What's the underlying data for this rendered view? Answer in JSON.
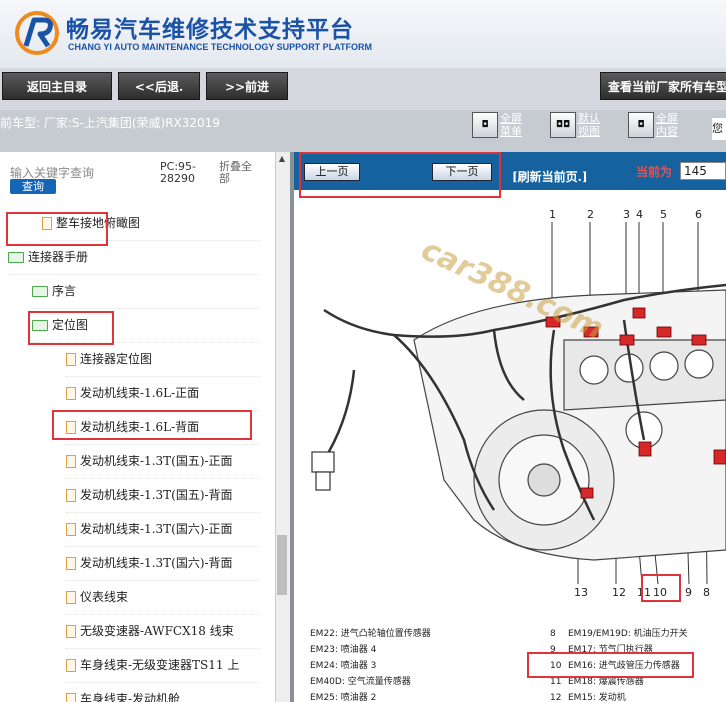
{
  "header": {
    "title_cn": "畅易汽车维修技术支持平台",
    "title_en": "CHANG YI AUTO MAINTENANCE TECHNOLOGY SUPPORT PLATFORM"
  },
  "nav": {
    "home": "返回主目录",
    "back": "<<后退.",
    "forward": ">>前进",
    "view_all": "查看当前厂家所有车型"
  },
  "infobar": {
    "car_model": "前车型:  厂家:S-上汽集团(荣威)RX32019",
    "btn_fullscreen_menu": "全屏菜单",
    "btn_default_view": "默认视图",
    "btn_fullscreen_content": "全屏内容",
    "right_text": "您"
  },
  "left": {
    "search_placeholder": "输入关键字查询",
    "search_button": "查询",
    "pc_label": "PC:95-28290",
    "collapse_all": "折叠全部",
    "tree": [
      {
        "label": "整车接地俯瞰图",
        "type": "file",
        "indent": 42
      },
      {
        "label": "连接器手册",
        "type": "folder",
        "indent": 8
      },
      {
        "label": "序言",
        "type": "folder",
        "indent": 32
      },
      {
        "label": "定位图",
        "type": "folder",
        "indent": 32
      },
      {
        "label": "连接器定位图",
        "type": "file",
        "indent": 66
      },
      {
        "label": "发动机线束-1.6L-正面",
        "type": "file",
        "indent": 66
      },
      {
        "label": "发动机线束-1.6L-背面",
        "type": "file",
        "indent": 66
      },
      {
        "label": "发动机线束-1.3T(国五)-正面",
        "type": "file",
        "indent": 66
      },
      {
        "label": "发动机线束-1.3T(国五)-背面",
        "type": "file",
        "indent": 66
      },
      {
        "label": "发动机线束-1.3T(国六)-正面",
        "type": "file",
        "indent": 66
      },
      {
        "label": "发动机线束-1.3T(国六)-背面",
        "type": "file",
        "indent": 66
      },
      {
        "label": "仪表线束",
        "type": "file",
        "indent": 66
      },
      {
        "label": "无级变速器-AWFCX18 线束",
        "type": "file",
        "indent": 66
      },
      {
        "label": "车身线束-无级变速器TS11 上",
        "type": "file",
        "indent": 66
      },
      {
        "label": "车身线束-发动机舱",
        "type": "file",
        "indent": 66
      }
    ]
  },
  "viewer": {
    "prev": "上一页",
    "next": "下一页",
    "refresh": "[刷新当前页.]",
    "current_page_label": "当前为",
    "current_page": "145",
    "watermark": "car388.com",
    "callouts_top": [
      "1",
      "2",
      "3",
      "4",
      "5",
      "6"
    ],
    "callouts_bottom": [
      "13",
      "12",
      "11",
      "10",
      "9",
      "8"
    ],
    "legend": [
      {
        "num": "",
        "code": "EM22",
        "desc": ": 进气凸轮轴位置传感器"
      },
      {
        "num": "",
        "code": "EM23",
        "desc": ": 喷油器 4"
      },
      {
        "num": "",
        "code": "EM24",
        "desc": ": 喷油器 3"
      },
      {
        "num": "",
        "code": "EM40D",
        "desc": ": 空气流量传感器"
      },
      {
        "num": "",
        "code": "EM25",
        "desc": ": 喷油器 2"
      },
      {
        "num": "8",
        "code": "EM19/EM19D",
        "desc": ": 机油压力开关"
      },
      {
        "num": "9",
        "code": "EM17",
        "desc": ": 节气门执行器"
      },
      {
        "num": "10",
        "code": "EM16",
        "desc": ": 进气歧管压力传感器"
      },
      {
        "num": "11",
        "code": "EM18",
        "desc": ": 爆震传感器"
      },
      {
        "num": "12",
        "code": "EM15",
        "desc": ": 发动机"
      }
    ]
  },
  "colors": {
    "accent_red": "#e0333a",
    "toolbar_blue": "#15629e",
    "title_blue": "#1a52a6"
  }
}
